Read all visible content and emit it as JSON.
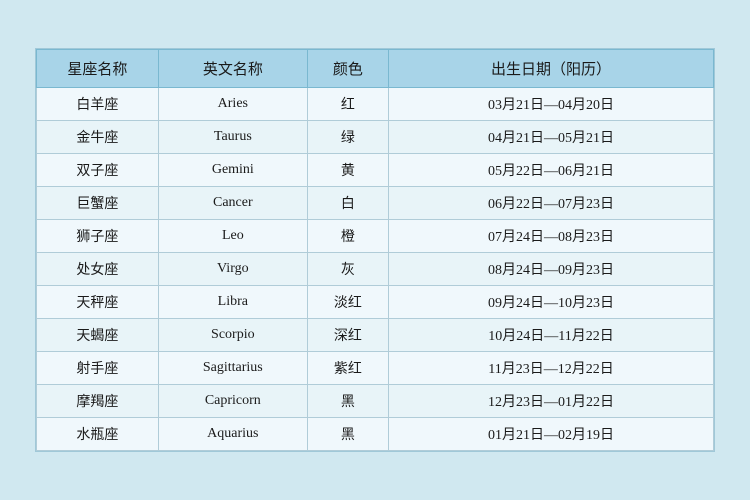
{
  "table": {
    "headers": {
      "zh_name": "星座名称",
      "en_name": "英文名称",
      "color": "颜色",
      "birthdate": "出生日期（阳历）"
    },
    "rows": [
      {
        "zh": "白羊座",
        "en": "Aries",
        "color": "红",
        "date": "03月21日—04月20日"
      },
      {
        "zh": "金牛座",
        "en": "Taurus",
        "color": "绿",
        "date": "04月21日—05月21日"
      },
      {
        "zh": "双子座",
        "en": "Gemini",
        "color": "黄",
        "date": "05月22日—06月21日"
      },
      {
        "zh": "巨蟹座",
        "en": "Cancer",
        "color": "白",
        "date": "06月22日—07月23日"
      },
      {
        "zh": "狮子座",
        "en": "Leo",
        "color": "橙",
        "date": "07月24日—08月23日"
      },
      {
        "zh": "处女座",
        "en": "Virgo",
        "color": "灰",
        "date": "08月24日—09月23日"
      },
      {
        "zh": "天秤座",
        "en": "Libra",
        "color": "淡红",
        "date": "09月24日—10月23日"
      },
      {
        "zh": "天蝎座",
        "en": "Scorpio",
        "color": "深红",
        "date": "10月24日—11月22日"
      },
      {
        "zh": "射手座",
        "en": "Sagittarius",
        "color": "紫红",
        "date": "11月23日—12月22日"
      },
      {
        "zh": "摩羯座",
        "en": "Capricorn",
        "color": "黑",
        "date": "12月23日—01月22日"
      },
      {
        "zh": "水瓶座",
        "en": "Aquarius",
        "color": "黑",
        "date": "01月21日—02月19日"
      }
    ]
  }
}
